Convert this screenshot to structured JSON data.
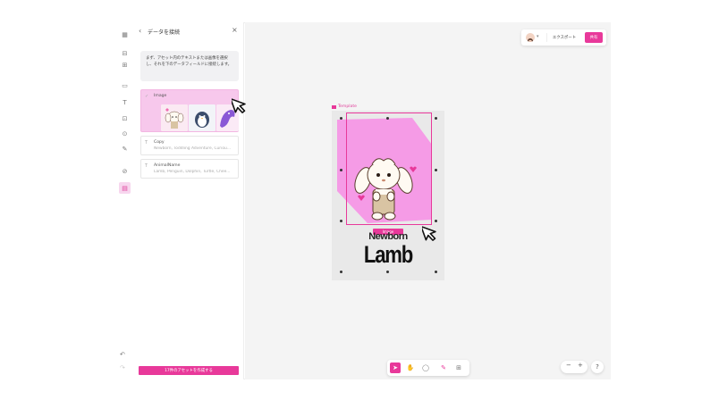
{
  "panel": {
    "title": "データを接続",
    "info_text": "まず、アセット内のテキストまたは画像を選択し、それを下のデータフィールドに接続します。",
    "fields": [
      {
        "icon": "image-icon",
        "label": "Image",
        "value": ""
      },
      {
        "icon": "text-icon",
        "label": "Copy",
        "value": "Newborn, Toddling Adventure, Curiou..."
      },
      {
        "icon": "text-icon",
        "label": "AnimalName",
        "value": "Lamb, Penguin, Dolphin, Turtle, Chee..."
      }
    ],
    "create_button": "17件のアセットを作成する"
  },
  "topbar": {
    "export_label": "エクスポート",
    "share_label": "共有"
  },
  "canvas": {
    "template_label": "Template",
    "image_tag": "Image",
    "headline": "Newborn",
    "animal_name": "Lamb"
  },
  "zoom": {
    "minus": "−",
    "plus": "+"
  },
  "help_label": "?",
  "colors": {
    "accent": "#e8399a",
    "selection_fill": "#f7c8ec",
    "artboard_shape": "#f59be6"
  }
}
